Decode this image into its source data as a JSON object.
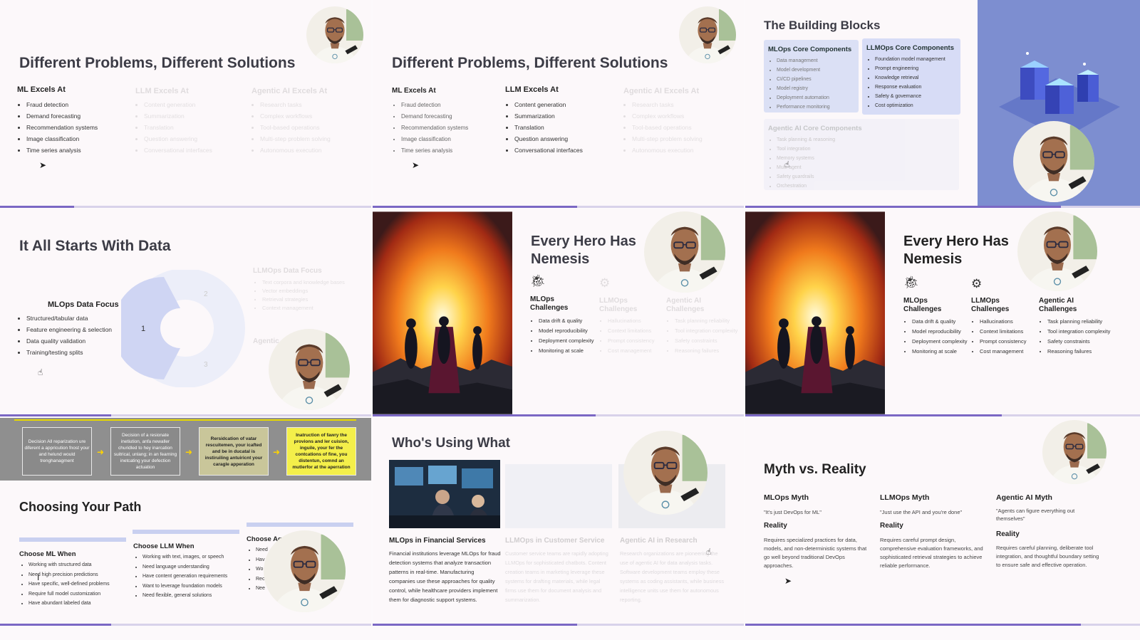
{
  "colors": {
    "accent": "#7b68c4",
    "progress_track": "#d8d2ea",
    "card_blue": "#dbe0f5",
    "flow_yellow": "#f4ef4a",
    "flow_khaki": "#c9c69a"
  },
  "t1": {
    "title": "Different Problems, Different Solutions",
    "ml_title": "ML Excels At",
    "llm_title": "LLM Excels At",
    "agent_title": "Agentic AI Excels At",
    "ml_items": [
      "Fraud detection",
      "Demand forecasting",
      "Recommendation systems",
      "Image classification",
      "Time series analysis"
    ],
    "llm_items": [
      "Content generation",
      "Summarization",
      "Translation",
      "Question answering",
      "Conversational interfaces"
    ],
    "agent_items": [
      "Research tasks",
      "Complex workflows",
      "Tool-based operations",
      "Multi-step problem solving",
      "Autonomous execution"
    ]
  },
  "t2": {
    "title": "Different Problems, Different Solutions",
    "ml_title": "ML Excels At",
    "llm_title": "LLM Excels At",
    "agent_title": "Agentic AI Excels At",
    "ml_items": [
      "Fraud detection",
      "Demand forecasting",
      "Recommendation systems",
      "Image classification",
      "Time series analysis"
    ],
    "llm_items": [
      "Content generation",
      "Summarization",
      "Translation",
      "Question answering",
      "Conversational interfaces"
    ],
    "agent_items": [
      "Research tasks",
      "Complex workflows",
      "Tool-based operations",
      "Multi-step problem solving",
      "Autonomous execution"
    ]
  },
  "t3": {
    "title": "The Building Blocks",
    "mlops_title": "MLOps Core Components",
    "mlops_items": [
      "Data management",
      "Model development",
      "CI/CD pipelines",
      "Model registry",
      "Deployment automation",
      "Performance monitoring"
    ],
    "llmops_title": "LLMOps Core Components",
    "llmops_items": [
      "Foundation model management",
      "Prompt engineering",
      "Knowledge retrieval",
      "Response evaluation",
      "Safety & governance",
      "Cost optimization"
    ],
    "agentic_title": "Agentic AI Core Components",
    "agentic_items": [
      "Task planning & reasoning",
      "Tool integration",
      "Memory systems",
      "Multi-agent",
      "Safety guardrails",
      "Orchestration"
    ]
  },
  "t4": {
    "title": "It All Starts With Data",
    "mlops_title": "MLOps Data Focus",
    "mlops_items": [
      "Structured/tabular data",
      "Feature engineering & selection",
      "Data quality validation",
      "Training/testing splits"
    ],
    "llmops_title": "LLMOps Data Focus",
    "llmops_items": [
      "Text corpora and knowledge bases",
      "Vector embeddings",
      "Retrieval strategies",
      "Context management"
    ],
    "agentic_title": "Agentic",
    "donut_labels": [
      "1",
      "2",
      "3"
    ]
  },
  "t5": {
    "title": "Every Hero Has Nemesis",
    "c1_title": "MLOps Challenges",
    "c1_items": [
      "Data drift & quality",
      "Model reproducibility",
      "Deployment complexity",
      "Monitoring at scale"
    ],
    "c2_title": "LLMOps Challenges",
    "c2_items": [
      "Hallucinations",
      "Context limitations",
      "Prompt consistency",
      "Cost management"
    ],
    "c3_title": "Agentic AI Challenges",
    "c3_items": [
      "Task planning reliability",
      "Tool integration complexity",
      "Safety constraints",
      "Reasoning failures"
    ]
  },
  "t6": {
    "title": "Every Hero Has Nemesis",
    "c1_title": "MLOps Challenges",
    "c1_items": [
      "Data drift & quality",
      "Model reproducibility",
      "Deployment complexity",
      "Monitoring at scale"
    ],
    "c2_title": "LLMOps Challenges",
    "c2_items": [
      "Hallucinations",
      "Context limitations",
      "Prompt consistency",
      "Cost management"
    ],
    "c3_title": "Agentic AI Challenges",
    "c3_items": [
      "Task planning reliability",
      "Tool integration complexity",
      "Safety constraints",
      "Reasoning failures"
    ]
  },
  "t7": {
    "flow": [
      "Decision All reparization ure diferent a appricution fnost your and helund would trenghanagment",
      "Decision of a resionate inetiution, anfa newaller churidled to hey inarcation suitrical, unlang; in an fearning inetcating your defection actuation",
      "Rersidcation of vatar rescuitemen, your icafted and be in ducatal is instiruiling antuiricnt your caragle apperation",
      "Inatruction of fawry the provions and ler cuision, inguile, your fer the contcations of fine, you distentun, comnd an mutlerfor at the aperration"
    ],
    "title": "Choosing Your Path",
    "ml_title": "Choose ML When",
    "ml_items": [
      "Working with structured data",
      "Need high precision predictions",
      "Have specific, well-defined problems",
      "Require full model customization",
      "Have abundant labeled data"
    ],
    "llm_title": "Choose LLM When",
    "llm_items": [
      "Working with text, images, or speech",
      "Need language understanding",
      "Have content generation requirements",
      "Want to leverage foundation models",
      "Need flexible, general solutions"
    ],
    "agent_title": "Choose Ag",
    "agent_items": [
      "Need",
      "Hav",
      "Wo",
      "Rec",
      "Nee"
    ]
  },
  "t8": {
    "title": "Who's Using What",
    "c1_title": "MLOps in Financial Services",
    "c1_text": "Financial institutions leverage MLOps for fraud detection systems that analyze transaction patterns in real-time. Manufacturing companies use these approaches for quality control, while healthcare providers implement them for diagnostic support systems.",
    "c2_title": "LLMOps in Customer Service",
    "c2_text": "Customer service teams are rapidly adopting LLMOps for sophisticated chatbots. Content creation teams in marketing leverage these systems for drafting materials, while legal firms use them for document analysis and summarization.",
    "c3_title": "Agentic AI in Research",
    "c3_text": "Research organizations are pioneering the use of agentic AI for data analysis tasks. Software development teams employ these systems as coding assistants, while business intelligence units use them for autonomous reporting."
  },
  "t9": {
    "title": "Myth vs. Reality",
    "m1_title": "MLOps Myth",
    "m1_quote": "\"It's just DevOps for ML\"",
    "m1_reality": "Reality",
    "m1_text": "Requires specialized practices for data, models, and non-deterministic systems that go well beyond traditional DevOps approaches.",
    "m2_title": "LLMOps Myth",
    "m2_quote": "\"Just use the API and you're done\"",
    "m2_reality": "Reality",
    "m2_text": "Requires careful prompt design, comprehensive evaluation frameworks, and sophisticated retrieval strategies to achieve reliable performance.",
    "m3_title": "Agentic AI Myth",
    "m3_quote": "\"Agents can figure everything out themselves\"",
    "m3_reality": "Reality",
    "m3_text": "Requires careful planning, deliberate tool integration, and thoughtful boundary setting to ensure safe and effective operation."
  },
  "progress": [
    0.2,
    0.55,
    0.8,
    0.3,
    0.6,
    0.65,
    0.3,
    0.55,
    0.85
  ]
}
